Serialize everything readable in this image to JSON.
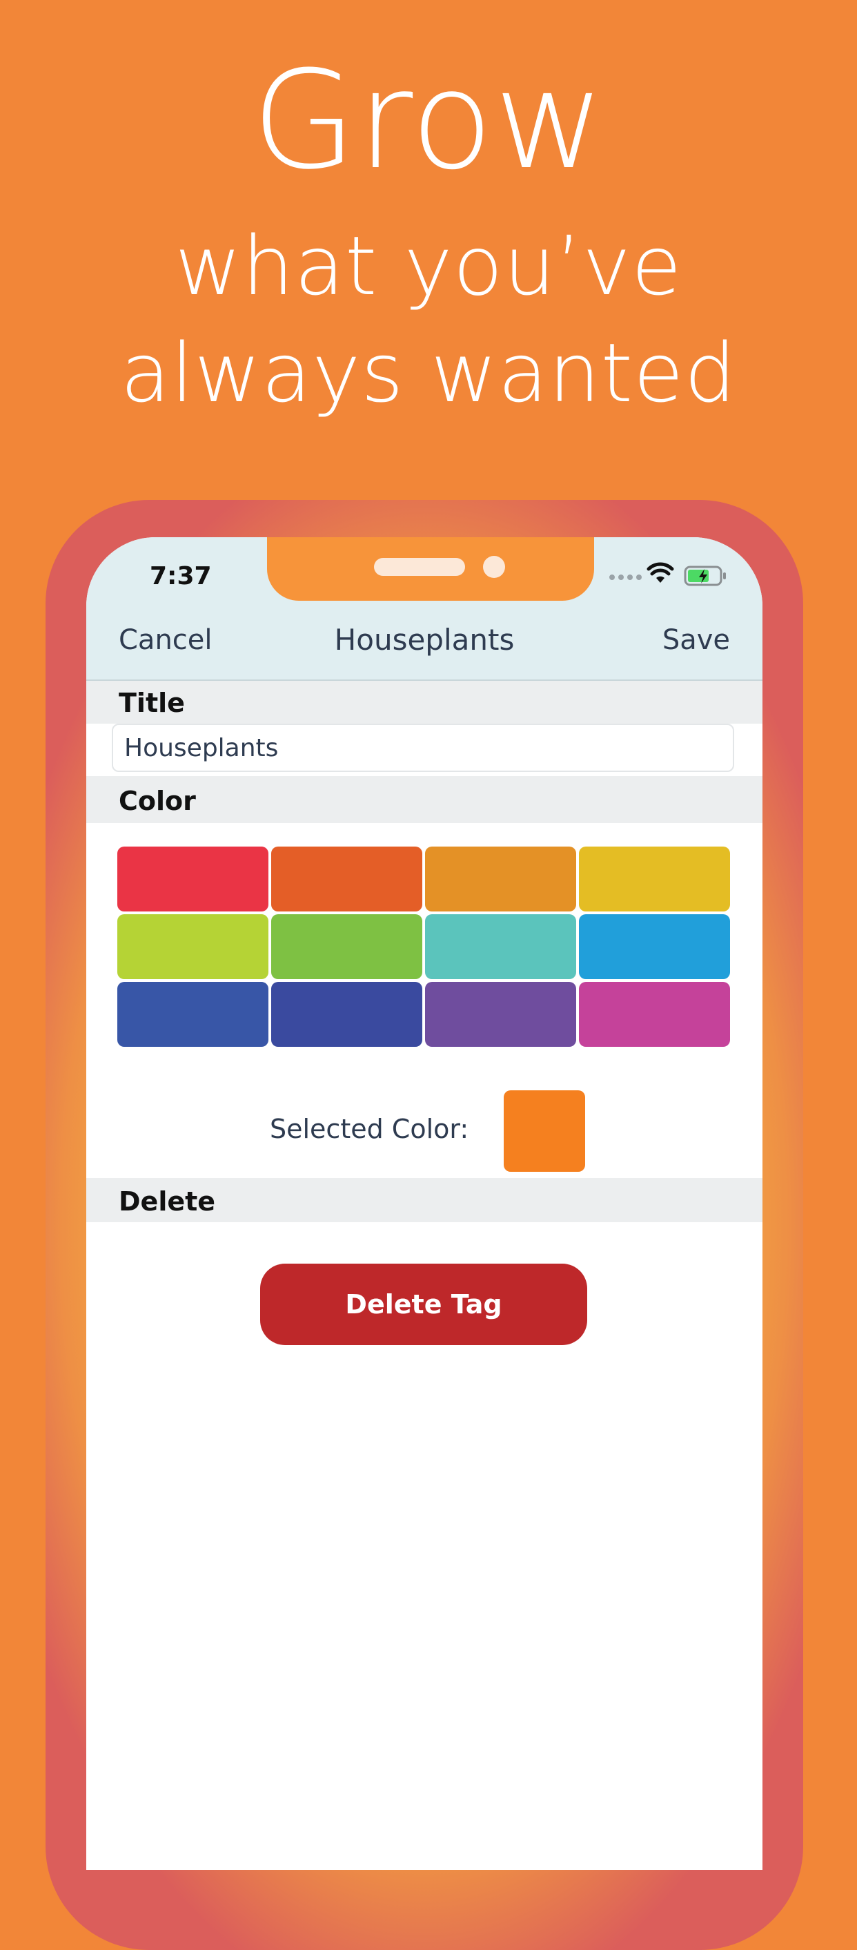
{
  "headline": {
    "line1": "Grow",
    "line2": "what you’ve",
    "line3": "always wanted"
  },
  "status_bar": {
    "time": "7:37",
    "icons": [
      "cellular-signal-icon",
      "wifi-icon",
      "battery-charging-icon"
    ]
  },
  "nav": {
    "cancel_label": "Cancel",
    "title": "Houseplants",
    "save_label": "Save"
  },
  "sections": {
    "title_header": "Title",
    "color_header": "Color",
    "delete_header": "Delete"
  },
  "title_field": {
    "value": "Houseplants"
  },
  "colors": [
    "#EA3445",
    "#E45E27",
    "#E49126",
    "#E4BD24",
    "#B5D335",
    "#7EC143",
    "#5BC4BC",
    "#219FDA",
    "#3856A7",
    "#3A4A9F",
    "#6F4D9E",
    "#C5429A"
  ],
  "selected_color": {
    "label": "Selected Color:",
    "value": "#F5801F"
  },
  "delete_button": {
    "label": "Delete Tag"
  },
  "theme": {
    "background": "#F28638",
    "navbar": "#E0EEF1",
    "section_header": "#ECEEEF",
    "delete_button": "#BE282A"
  }
}
